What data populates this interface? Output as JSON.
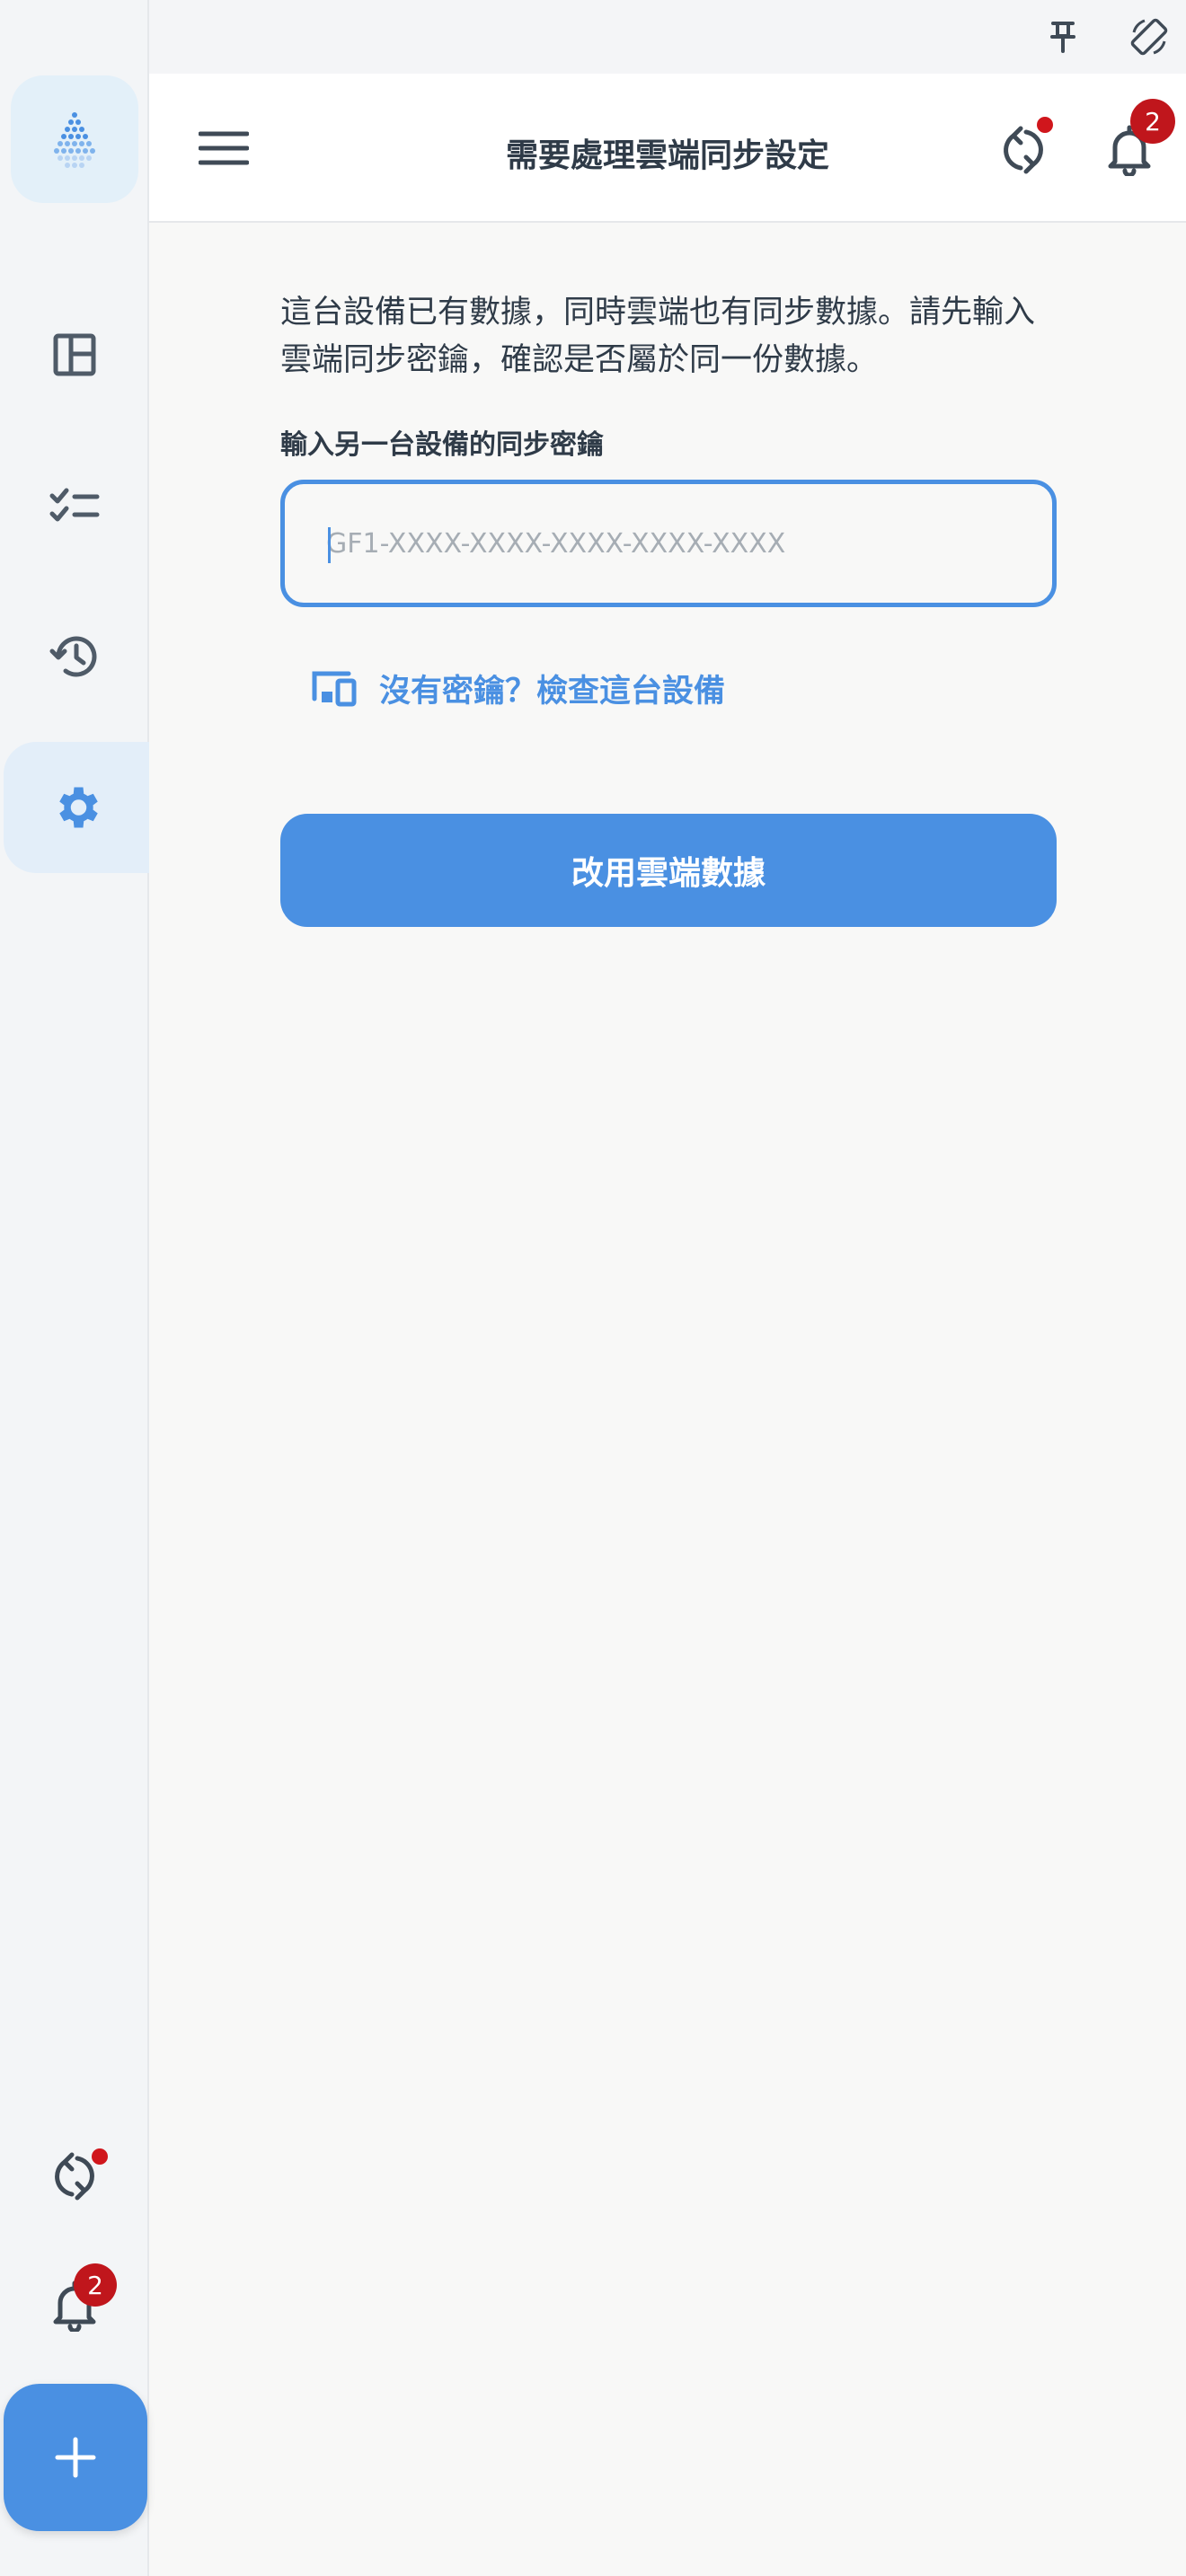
{
  "header": {
    "title": "需要處理雲端同步設定",
    "notification_count": "2"
  },
  "sidebar": {
    "notification_count": "2"
  },
  "main": {
    "description": "這台設備已有數據，同時雲端也有同步數據。請先輸入雲端同步密鑰，確認是否屬於同一份數據。",
    "field_label": "輸入另一台設備的同步密鑰",
    "key_input": {
      "placeholder": "GF1-XXXX-XXXX-XXXX-XXXX-XXXX",
      "value": ""
    },
    "no_key_link": "沒有密鑰？檢查這台設備",
    "use_cloud_button": "改用雲端數據"
  },
  "colors": {
    "accent": "#4a90e2",
    "badge": "#c0161c",
    "text": "#2f3b48"
  }
}
